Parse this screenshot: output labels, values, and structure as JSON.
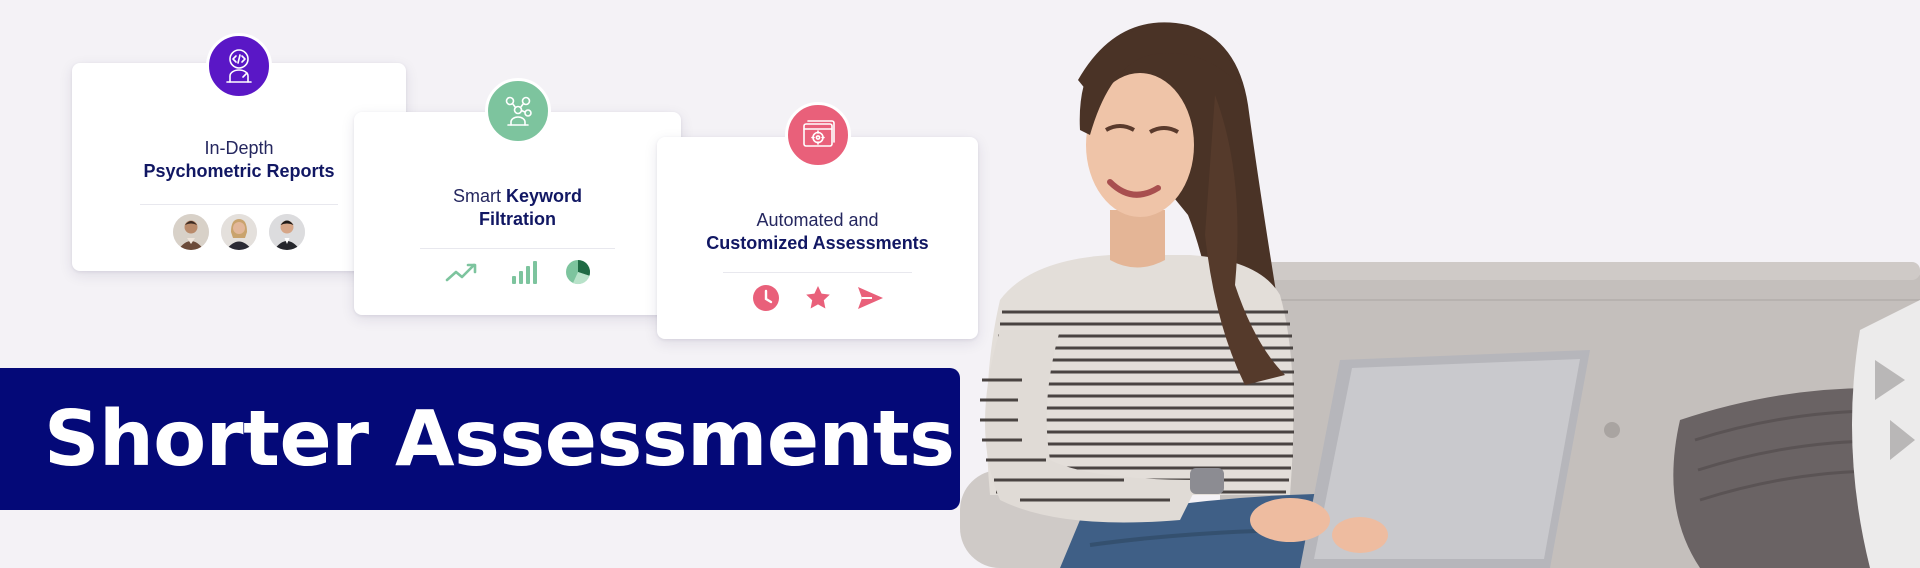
{
  "cards": [
    {
      "line1": "In-Depth",
      "line2": "Psychometric Reports",
      "badge_icon": "coding-person-icon",
      "badge_color": "#5a17c6",
      "icons": [
        "avatar",
        "avatar",
        "avatar"
      ]
    },
    {
      "line1_a": "Smart ",
      "line1_b": "Keyword",
      "line2": "Filtration",
      "badge_icon": "network-person-icon",
      "badge_color": "#7dc49e",
      "icons": [
        "trend-up-icon",
        "bar-chart-icon",
        "pie-chart-icon"
      ]
    },
    {
      "line1": "Automated and",
      "line2": "Customized Assessments",
      "badge_icon": "browser-target-icon",
      "badge_color": "#e9607a",
      "icons": [
        "clock-icon",
        "star-icon",
        "send-icon"
      ]
    }
  ],
  "banner": {
    "title": "Shorter Assessments",
    "background": "#040978"
  },
  "colors": {
    "page_background": "#f4f2f6",
    "heading_navy": "#111763",
    "green_accent": "#7dc49e",
    "pink_accent": "#e9607a"
  }
}
